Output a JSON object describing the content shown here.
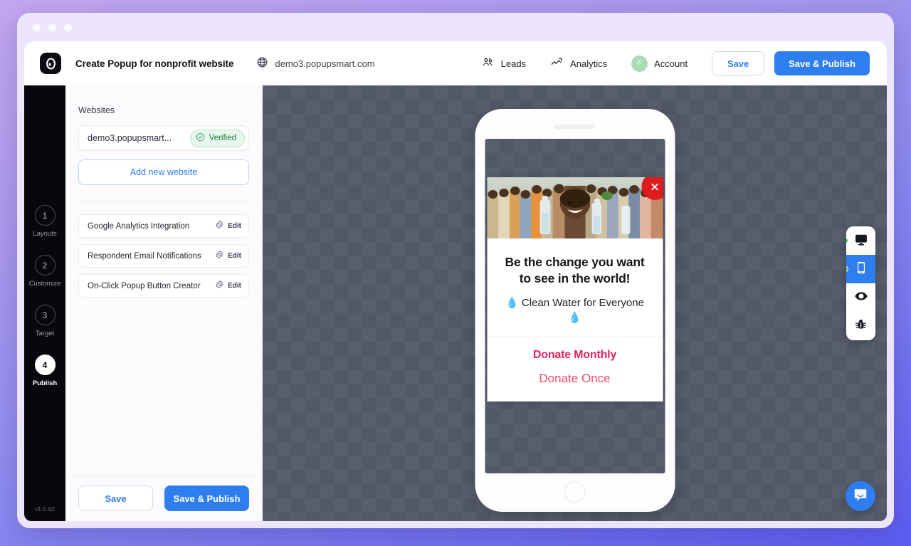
{
  "window": {
    "traffic_lights": [
      "close",
      "minimize",
      "maximize"
    ]
  },
  "topbar": {
    "logo_icon": "popupsmart-logo-icon",
    "title": "Create Popup for nonprofit website",
    "globe_icon": "globe-icon",
    "domain": "demo3.popupsmart.com",
    "leads_icon": "people-icon",
    "leads_label": "Leads",
    "analytics_icon": "chart-line-icon",
    "analytics_label": "Analytics",
    "avatar_initial": "F",
    "account_label": "Account",
    "save_label": "Save",
    "save_publish_label": "Save & Publish"
  },
  "rail": {
    "steps": [
      {
        "number": "1",
        "label": "Layouts",
        "active": false
      },
      {
        "number": "2",
        "label": "Customize",
        "active": false
      },
      {
        "number": "3",
        "label": "Target",
        "active": false
      },
      {
        "number": "4",
        "label": "Publish",
        "active": true
      }
    ],
    "version": "v1.5.92"
  },
  "panel": {
    "heading": "Websites",
    "website": {
      "name": "demo3.popupsmart...",
      "status_icon": "check-circle-icon",
      "status_label": "Verified"
    },
    "add_website_label": "Add new website",
    "features": [
      {
        "name": "Google Analytics Integration",
        "edit_icon": "gear-icon",
        "edit_label": "Edit"
      },
      {
        "name": "Respondent Email Notifications",
        "edit_icon": "gear-icon",
        "edit_label": "Edit"
      },
      {
        "name": "On-Click Popup Button Creator",
        "edit_icon": "gear-icon",
        "edit_label": "Edit"
      }
    ],
    "save_label": "Save",
    "save_publish_label": "Save & Publish"
  },
  "preview": {
    "device": "mobile",
    "popup": {
      "image_alt": "children-holding-water-bottles-photo",
      "close_icon": "close-x-icon",
      "headline": "Be the change you want to see in the world!",
      "subtext": "💧 Clean Water for Everyone 💧",
      "cta_primary": "Donate Monthly",
      "cta_secondary": "Donate Once"
    }
  },
  "devbar": {
    "buttons": [
      {
        "icon": "desktop-icon",
        "name": "desktop-view",
        "selected": false,
        "has_dot": true
      },
      {
        "icon": "mobile-icon",
        "name": "mobile-view",
        "selected": true,
        "has_dot": true
      },
      {
        "icon": "eye-icon",
        "name": "preview-toggle",
        "selected": false,
        "has_dot": false
      },
      {
        "icon": "bug-icon",
        "name": "debug-toggle",
        "selected": false,
        "has_dot": false
      }
    ]
  },
  "intercom": {
    "icon": "chat-bubble-icon"
  },
  "colors": {
    "accent_blue": "#2f7ef0",
    "verified_green": "#1f7a40",
    "cta_pink": "#e4245e",
    "close_red": "#e01b1b",
    "rail_black": "#08080c",
    "canvas_grey": "#585e6e"
  }
}
